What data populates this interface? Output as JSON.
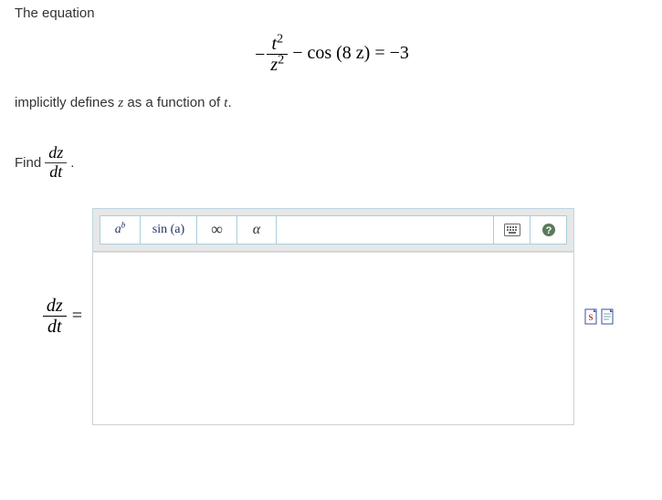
{
  "problem": {
    "intro": "The equation",
    "equation_latex": "-\\frac{t^2}{z^2} - \\cos(8z) = -3",
    "equation_parts": {
      "lead_minus": "−",
      "frac_num_base": "t",
      "frac_num_exp": "2",
      "frac_den_base": "z",
      "frac_den_exp": "2",
      "middle": " − cos (8 z) = −3"
    },
    "implicit_pre": "implicitly defines ",
    "implicit_var1": "z",
    "implicit_mid": " as a function of ",
    "implicit_var2": "t",
    "implicit_end": ".",
    "find_label": "Find",
    "find_deriv_num": "dz",
    "find_deriv_den": "dt",
    "find_period": "."
  },
  "answer": {
    "lhs_num": "dz",
    "lhs_den": "dt",
    "equals": "="
  },
  "toolbar": {
    "power_base": "a",
    "power_exp": "b",
    "trig": "sin (a)",
    "infinity": "∞",
    "alpha": "α"
  },
  "icons": {
    "keyboard": "keyboard-icon",
    "help": "help-icon",
    "doc1": "document-icon-script",
    "doc2": "document-icon-page"
  },
  "chart_data": null
}
